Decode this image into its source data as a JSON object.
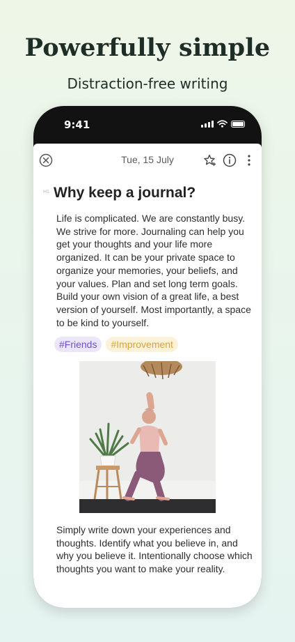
{
  "promo": {
    "headline": "Powerfully simple",
    "subheadline": "Distraction-free writing"
  },
  "status_bar": {
    "time": "9:41",
    "icons": [
      "cellular-signal-icon",
      "wifi-icon",
      "battery-icon"
    ]
  },
  "toolbar": {
    "close_icon": "close-circle-icon",
    "date": "Tue, 15 July",
    "star_icon": "star-add-icon",
    "info_icon": "info-icon",
    "more_icon": "more-vertical-icon"
  },
  "entry": {
    "heading_marker": "H1",
    "title": "Why keep a journal?",
    "paragraph1": "Life is complicated. We are constantly busy. We strive for more. Journaling can help you get your thoughts and your life more organized. It can be your private space to organize your memories, your beliefs, and your values. Plan and set long term goals. Build  your own vision of a great life, a best version of yourself. Most importantly, a space to be kind to yourself.",
    "tags": [
      "#Friends",
      "#Improvement"
    ],
    "paragraph2": "Simply write down your experiences and thoughts. Identify what you believe in, and why you believe it. Intentionally choose which thoughts you want to make your reality."
  },
  "colors": {
    "tag_friends_bg": "#ebe6fb",
    "tag_friends_text": "#6a52c9",
    "tag_improvement_bg": "#fcf1d9",
    "tag_improvement_text": "#d9a43a",
    "headline": "#1f2d27"
  }
}
